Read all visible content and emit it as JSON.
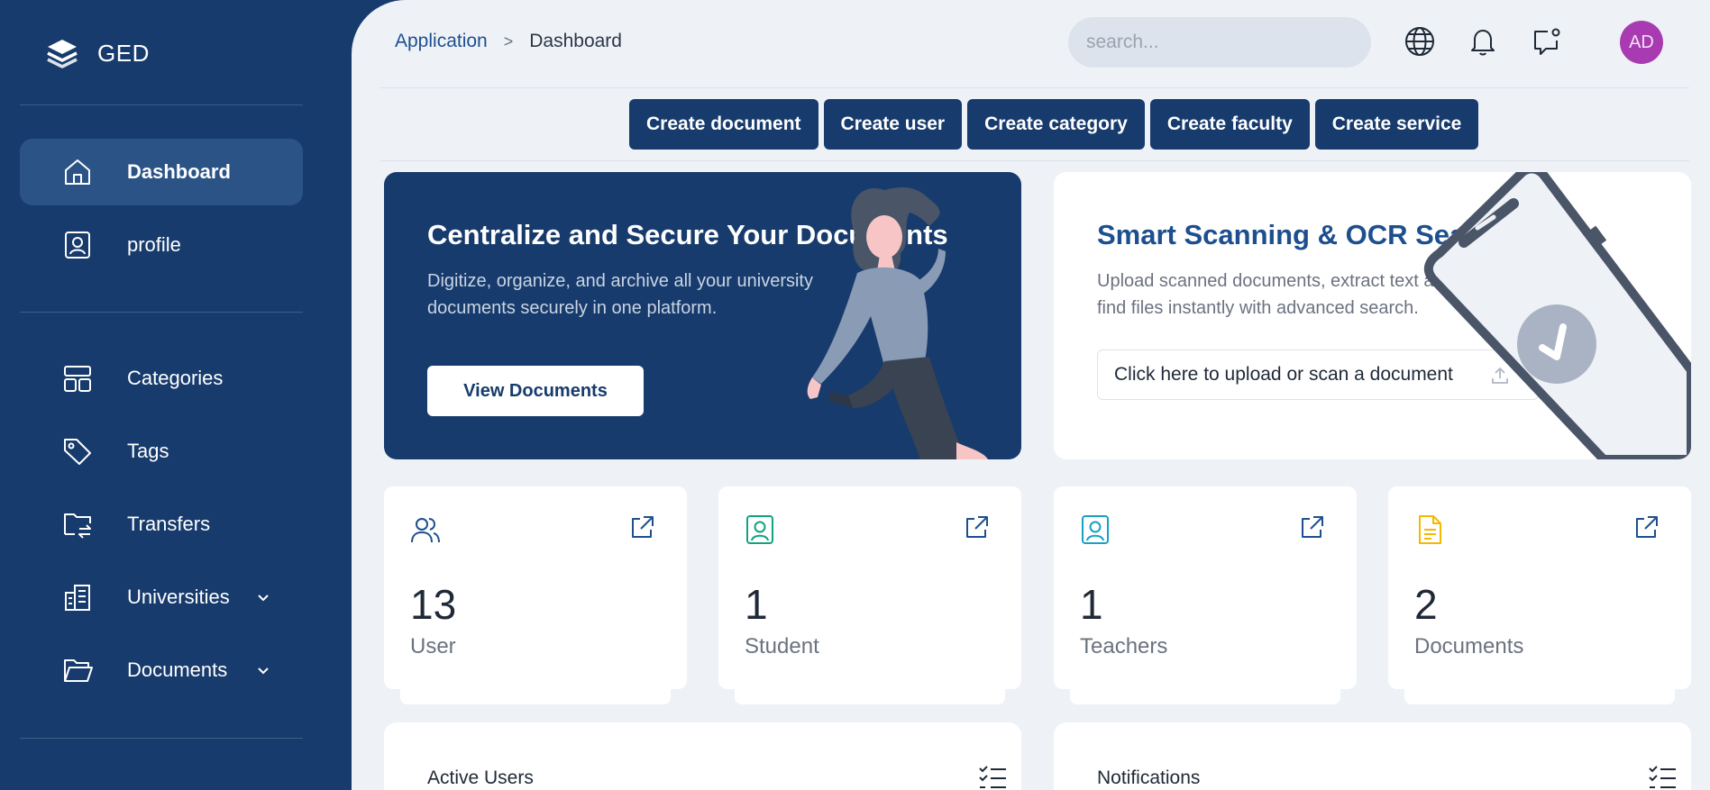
{
  "app": {
    "name": "GED"
  },
  "sidebar": {
    "items": [
      {
        "label": "Dashboard",
        "icon": "home-icon",
        "active": true
      },
      {
        "label": "profile",
        "icon": "profile-icon"
      },
      {
        "label": "Categories",
        "icon": "layout-icon"
      },
      {
        "label": "Tags",
        "icon": "tag-icon"
      },
      {
        "label": "Transfers",
        "icon": "folder-transfer-icon"
      },
      {
        "label": "Universities",
        "icon": "building-icon",
        "expandable": true
      },
      {
        "label": "Documents",
        "icon": "folder-open-icon",
        "expandable": true
      }
    ]
  },
  "header": {
    "breadcrumb": {
      "parent": "Application",
      "separator": ">",
      "current": "Dashboard"
    },
    "search": {
      "placeholder": "search..."
    },
    "icons": [
      "globe-icon",
      "bell-icon",
      "message-icon"
    ],
    "avatar_initials": "AD"
  },
  "actions": {
    "create_document": "Create document",
    "create_user": "Create user",
    "create_category": "Create category",
    "create_faculty": "Create faculty",
    "create_service": "Create service"
  },
  "hero_left": {
    "title": "Centralize and Secure Your Documents",
    "text": "Digitize, organize, and archive all your university documents securely in one platform.",
    "button": "View Documents"
  },
  "hero_right": {
    "title": "Smart Scanning & OCR Search",
    "text": "Upload scanned documents, extract text and find files instantly with advanced search.",
    "upload_label": "Click here to upload or scan a document"
  },
  "stats": [
    {
      "value": "13",
      "label": "User",
      "icon": "users-icon",
      "color": "#1d4f8f"
    },
    {
      "value": "1",
      "label": "Student",
      "icon": "student-badge-icon",
      "color": "#10a37f"
    },
    {
      "value": "1",
      "label": "Teachers",
      "icon": "teacher-badge-icon",
      "color": "#17a2c4"
    },
    {
      "value": "2",
      "label": "Documents",
      "icon": "document-icon",
      "color": "#f5b800"
    }
  ],
  "panels": {
    "active_users": "Active Users",
    "notifications": "Notifications"
  },
  "colors": {
    "primary": "#173b6c",
    "background": "#eef2f7",
    "avatar": "#a93bb2"
  }
}
